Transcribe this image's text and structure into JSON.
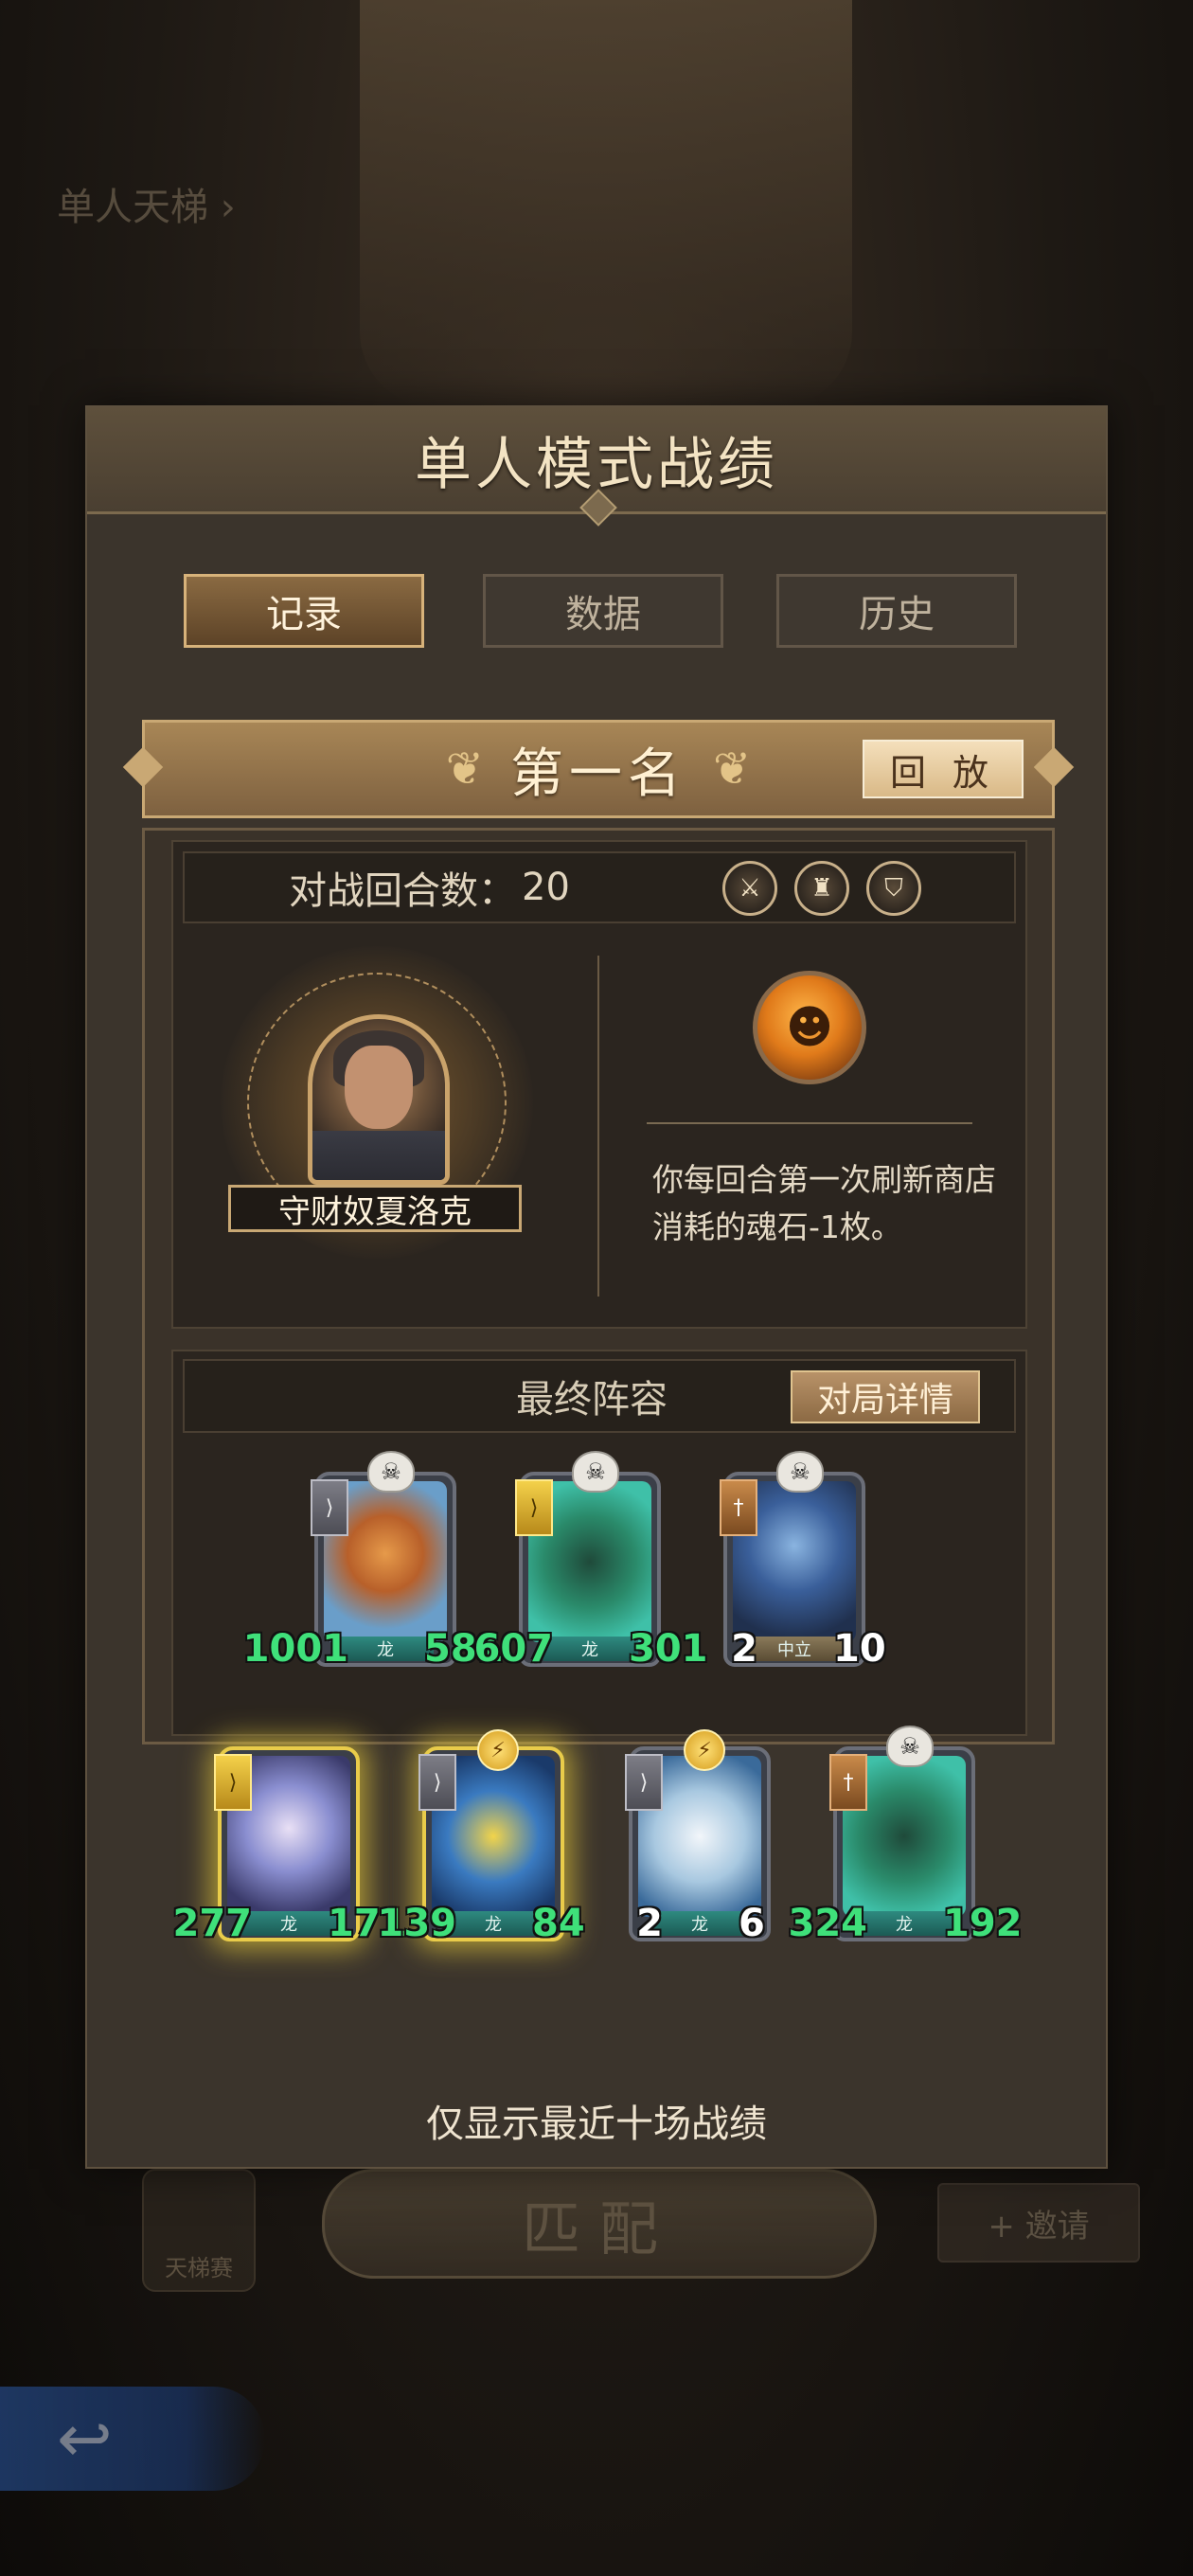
{
  "background": {
    "mode_label": "单人天梯 ›",
    "match_button": "匹配",
    "left_icon_label": "天梯赛",
    "right_button": "+ 邀请",
    "back_arrow": "↩"
  },
  "dialog": {
    "title": "单人模式战绩",
    "tabs": [
      {
        "label": "记录",
        "active": true
      },
      {
        "label": "数据",
        "active": false
      },
      {
        "label": "历史",
        "active": false
      }
    ],
    "rank": "第一名",
    "replay_label": "回 放",
    "turns_label": "对战回合数：",
    "turns_value": "20",
    "stat_icons": [
      "sword-icon",
      "armor-icon",
      "shield-icon"
    ],
    "hero_name": "守财奴夏洛克",
    "ability_description": "你每回合第一次刷新商店消耗的魂石-1枚。",
    "lineup_title": "最终阵容",
    "detail_button": "对局详情",
    "footer_note": "仅显示最近十场战绩"
  },
  "lineup": {
    "row1": [
      {
        "attack": "1001",
        "health": "581",
        "tribe": "龙",
        "stats_color": "green"
      },
      {
        "attack": "607",
        "health": "301",
        "tribe": "龙",
        "stats_color": "green"
      },
      {
        "attack": "2",
        "health": "10",
        "tribe": "中立",
        "stats_color": "white"
      }
    ],
    "row2": [
      {
        "attack": "277",
        "health": "171",
        "tribe": "龙",
        "stats_color": "green"
      },
      {
        "attack": "139",
        "health": "84",
        "tribe": "龙",
        "stats_color": "green"
      },
      {
        "attack": "2",
        "health": "6",
        "tribe": "龙",
        "stats_color": "white"
      },
      {
        "attack": "324",
        "health": "192",
        "tribe": "龙",
        "stats_color": "green"
      }
    ]
  }
}
